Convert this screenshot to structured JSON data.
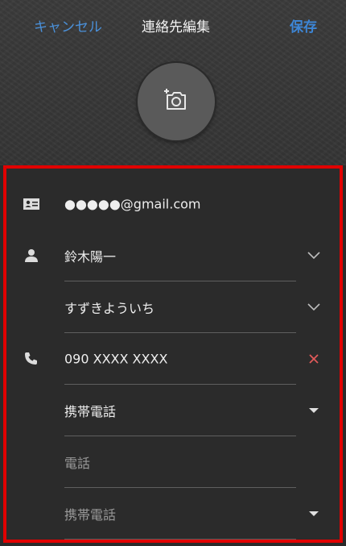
{
  "topbar": {
    "cancel_label": "キャンセル",
    "title": "連絡先編集",
    "save_label": "保存"
  },
  "account": {
    "email": "●●●●●@gmail.com",
    "icon": "contact-card-icon"
  },
  "name": {
    "icon": "person-icon",
    "full_name": "鈴木陽一",
    "phonetic": "すずきよういち"
  },
  "phone": {
    "icon": "phone-icon",
    "number": "090 XXXX XXXX",
    "type": "携帯電話"
  },
  "new_phone": {
    "placeholder": "電話",
    "type": "携帯電話"
  },
  "colors": {
    "accent": "#4a90d9",
    "highlight_border": "#e10000",
    "delete": "#e05a5a"
  }
}
